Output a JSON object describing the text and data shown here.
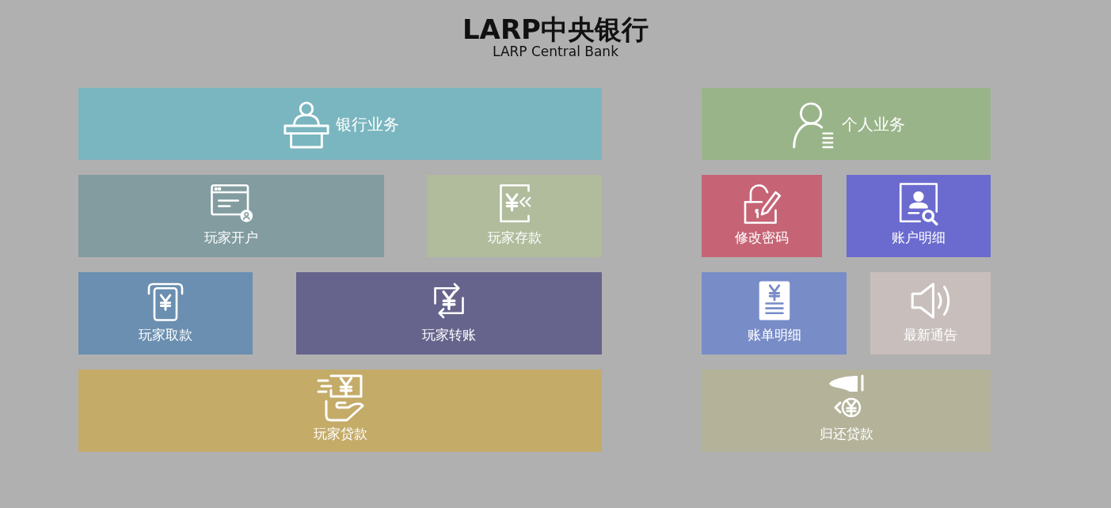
{
  "title": "LARP中央银行",
  "subtitle": "LARP Central Bank",
  "panels": [
    {
      "rows": [
        [
          {
            "label": "银行业务",
            "kind": "header",
            "color": "#7ab6bf"
          }
        ],
        [
          {
            "label": "玩家开户",
            "kind": "tile",
            "color": "#829ca0"
          },
          {
            "label": "玩家存款",
            "kind": "tile",
            "color": "#b0bc9c"
          }
        ],
        [
          {
            "label": "玩家取款",
            "kind": "tile",
            "color": "#6a8fb0"
          },
          {
            "label": "玩家转账",
            "kind": "tile",
            "color": "#66648c"
          }
        ],
        [
          {
            "label": "玩家贷款",
            "kind": "tile",
            "color": "#c4ab68"
          }
        ]
      ]
    },
    {
      "rows": [
        [
          {
            "label": "个人业务",
            "kind": "header",
            "color": "#9ab48a"
          }
        ],
        [
          {
            "label": "修改密码",
            "kind": "tile",
            "color": "#c66475"
          },
          {
            "label": "账户明细",
            "kind": "tile",
            "color": "#6b6bcf"
          }
        ],
        [
          {
            "label": "账单明细",
            "kind": "tile",
            "color": "#788cc8"
          },
          {
            "label": "最新通告",
            "kind": "tile",
            "color": "#c8bfbd"
          }
        ],
        [
          {
            "label": "归还贷款",
            "kind": "tile",
            "color": "#b4b39a"
          }
        ]
      ]
    }
  ]
}
